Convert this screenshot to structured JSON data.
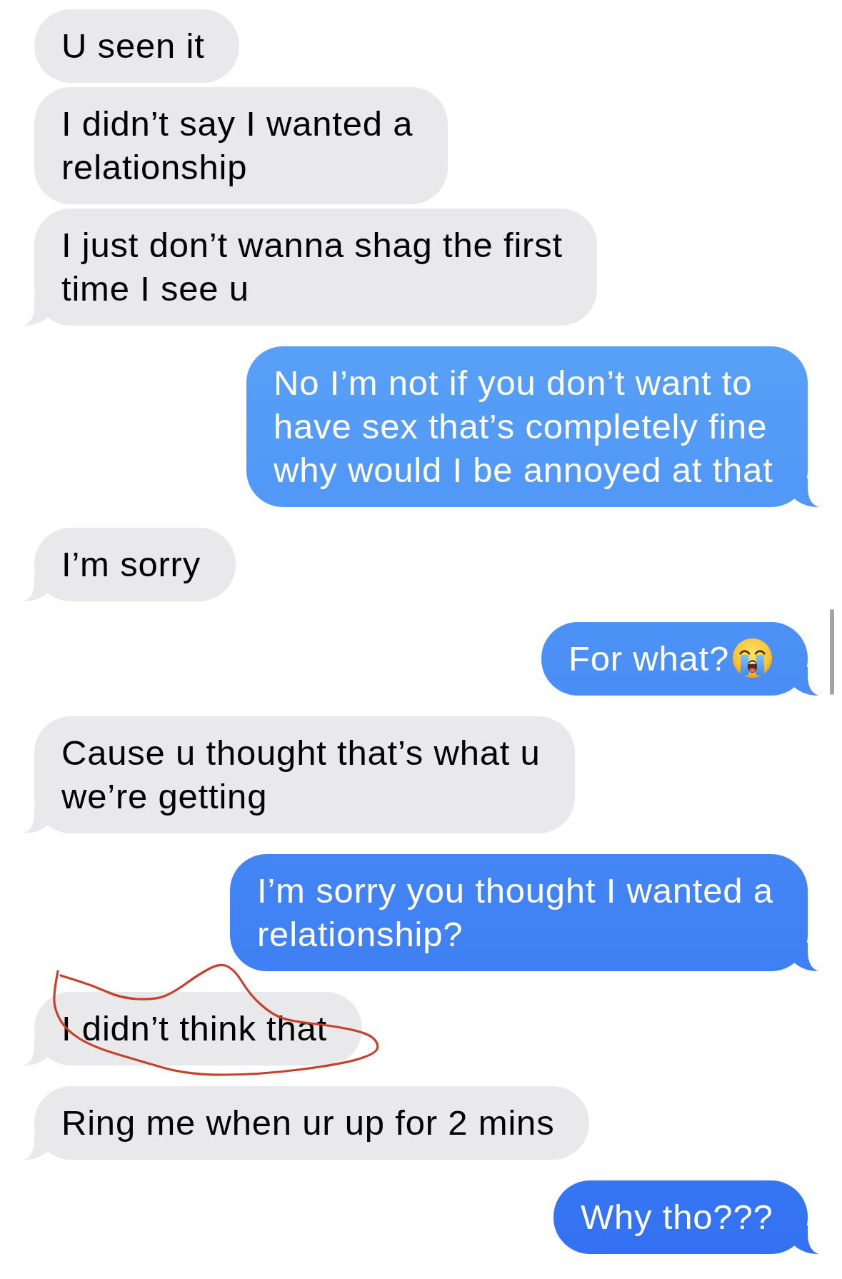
{
  "messages": [
    {
      "kind": "received",
      "text": "U seen it",
      "emoji": false,
      "tail": false,
      "circled": false
    },
    {
      "kind": "received",
      "text": "I didn’t say I wanted a relationship",
      "emoji": false,
      "tail": false,
      "circled": false
    },
    {
      "kind": "received",
      "text": "I just don’t wanna shag the first time I see u",
      "emoji": false,
      "tail": true,
      "circled": false
    },
    {
      "kind": "sent",
      "text": "No I’m not if you don’t want to have sex that’s completely fine why would I be annoyed at that",
      "emoji": false,
      "tail": true,
      "circled": false
    },
    {
      "kind": "received",
      "text": "I’m sorry",
      "emoji": false,
      "tail": true,
      "circled": false
    },
    {
      "kind": "sent",
      "text": "For what?",
      "emoji": true,
      "tail": true,
      "circled": false
    },
    {
      "kind": "received",
      "text": "Cause u thought that’s what u we’re getting",
      "emoji": false,
      "tail": true,
      "circled": false
    },
    {
      "kind": "sent",
      "text": "I’m sorry you thought I wanted a relationship?",
      "emoji": false,
      "tail": true,
      "circled": false
    },
    {
      "kind": "received",
      "text": "I didn’t think that",
      "emoji": false,
      "tail": true,
      "circled": true
    },
    {
      "kind": "received",
      "text": "Ring me when ur up for 2 mins",
      "emoji": false,
      "tail": true,
      "circled": false
    },
    {
      "kind": "sent",
      "text": "Why tho???",
      "emoji": false,
      "tail": true,
      "circled": false
    }
  ],
  "scroll_indicator": true
}
